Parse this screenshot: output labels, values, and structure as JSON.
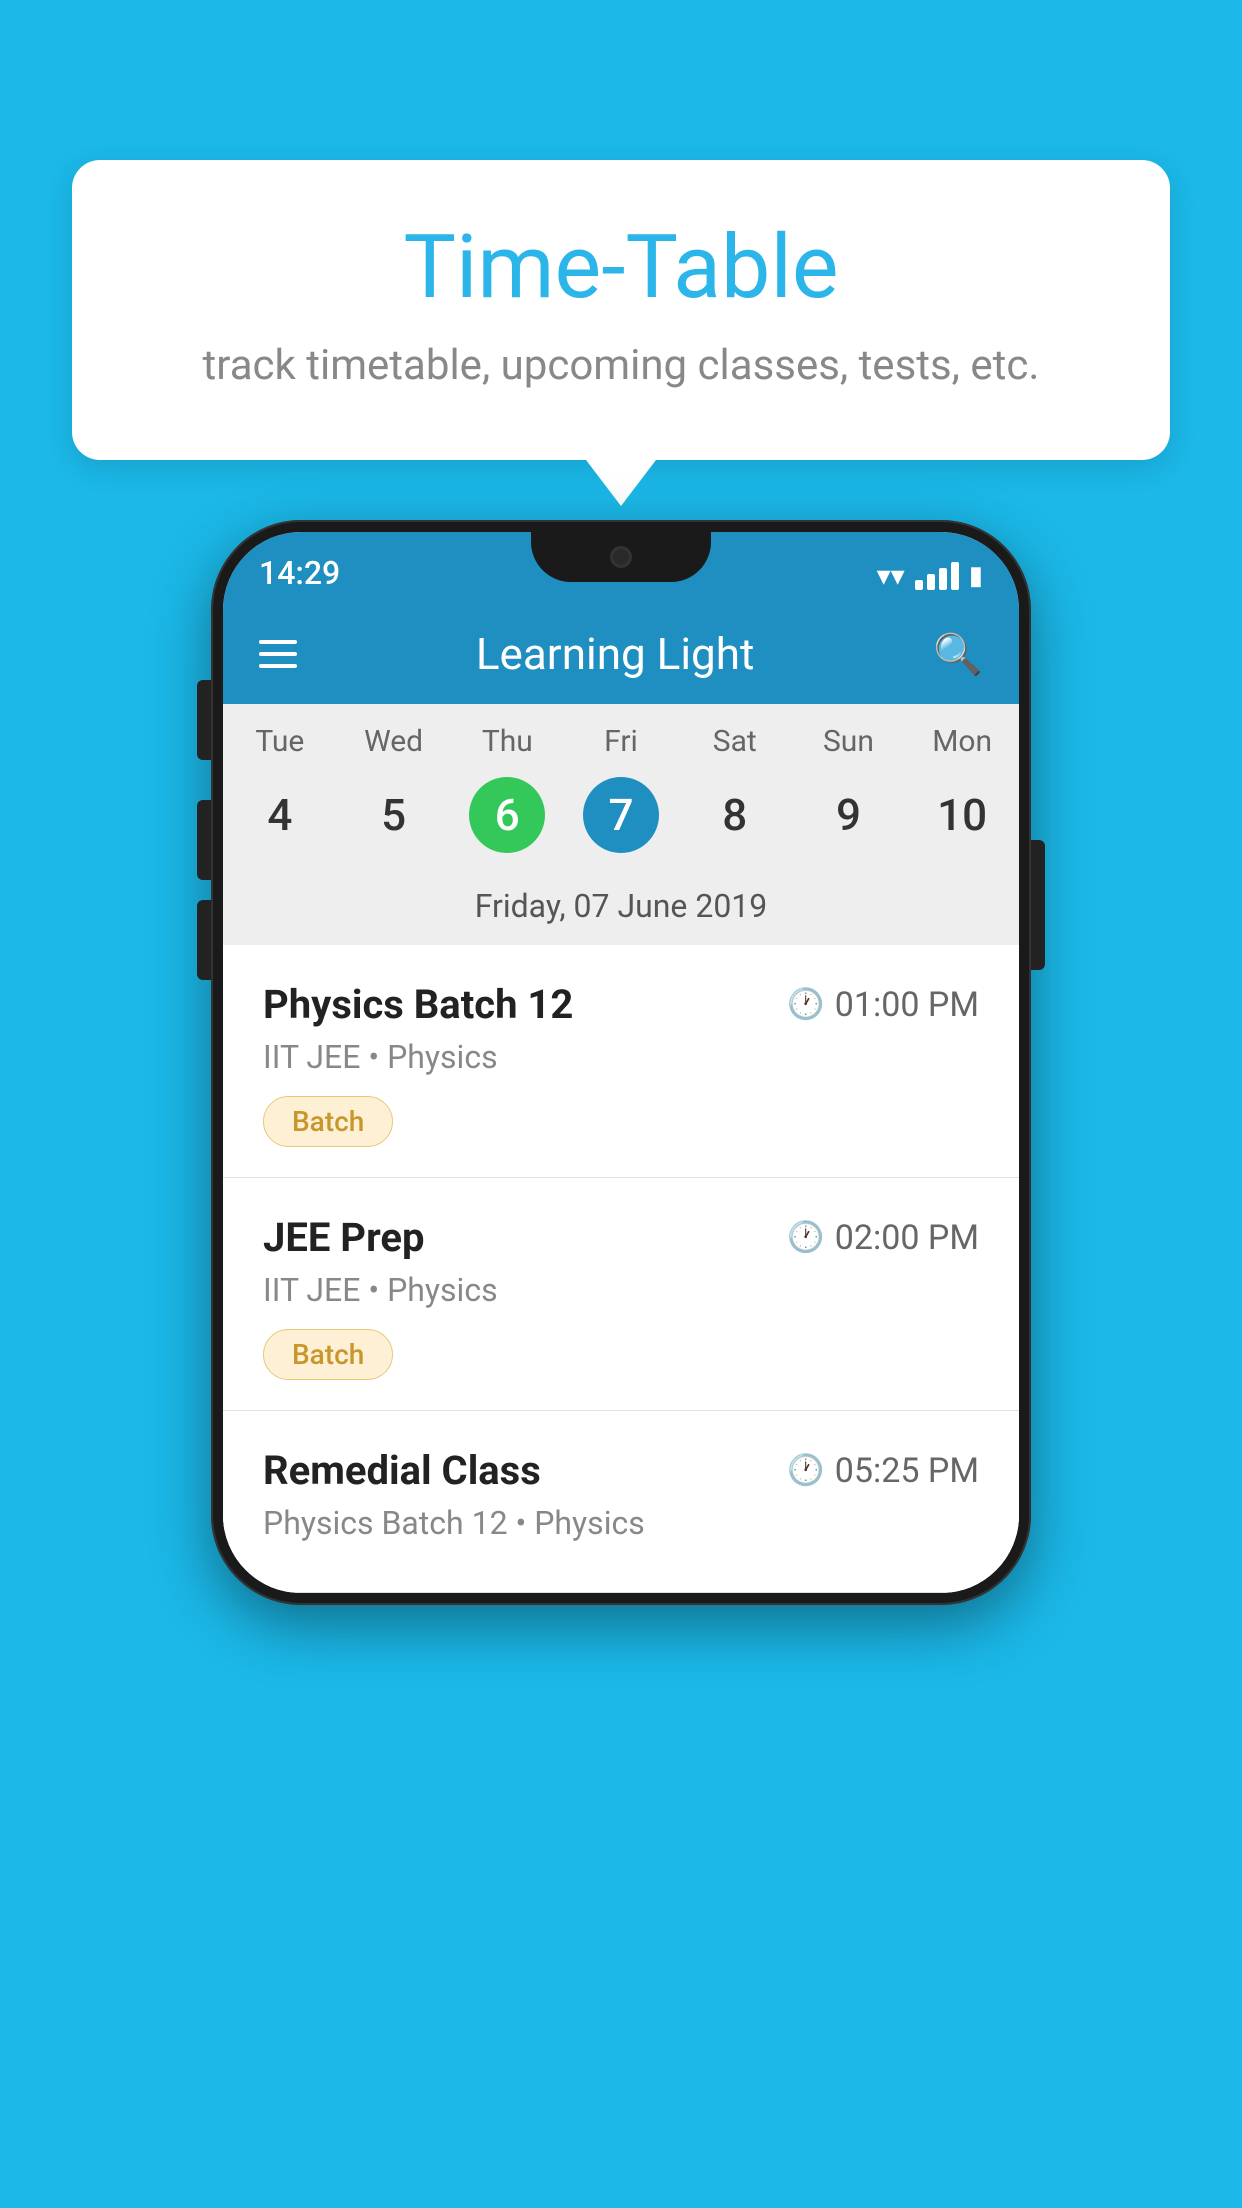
{
  "background_color": "#1bb8e8",
  "tooltip": {
    "title": "Time-Table",
    "subtitle": "track timetable, upcoming classes, tests, etc."
  },
  "phone": {
    "status_bar": {
      "time": "14:29"
    },
    "app_header": {
      "title": "Learning Light"
    },
    "calendar": {
      "days": [
        {
          "label": "Tue",
          "number": "4"
        },
        {
          "label": "Wed",
          "number": "5"
        },
        {
          "label": "Thu",
          "number": "6",
          "style": "green"
        },
        {
          "label": "Fri",
          "number": "7",
          "style": "blue"
        },
        {
          "label": "Sat",
          "number": "8"
        },
        {
          "label": "Sun",
          "number": "9"
        },
        {
          "label": "Mon",
          "number": "10"
        }
      ],
      "selected_date": "Friday, 07 June 2019"
    },
    "schedule_items": [
      {
        "title": "Physics Batch 12",
        "time": "01:00 PM",
        "subtitle": "IIT JEE • Physics",
        "badge": "Batch"
      },
      {
        "title": "JEE Prep",
        "time": "02:00 PM",
        "subtitle": "IIT JEE • Physics",
        "badge": "Batch"
      },
      {
        "title": "Remedial Class",
        "time": "05:25 PM",
        "subtitle": "Physics Batch 12 • Physics",
        "badge": null
      }
    ]
  }
}
